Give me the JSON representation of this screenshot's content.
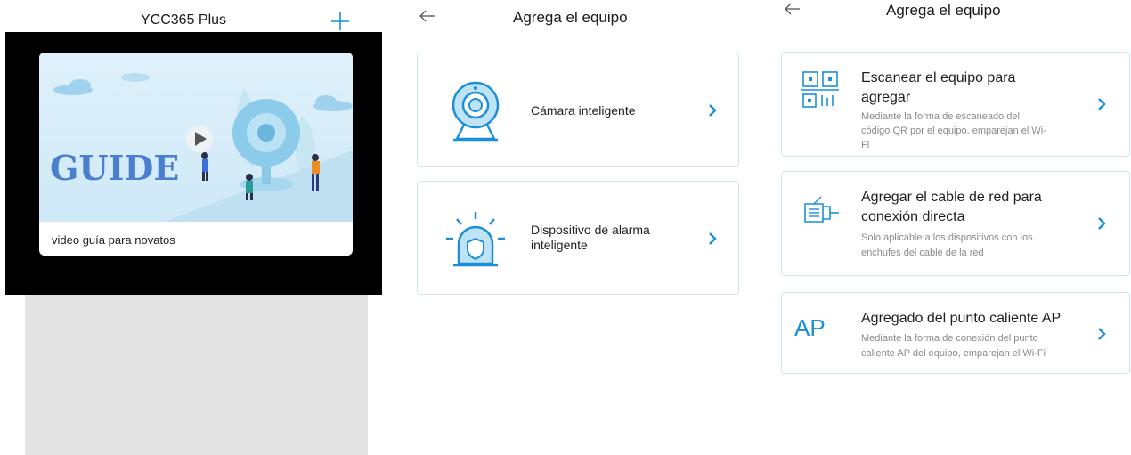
{
  "panel1": {
    "title": "YCC365 Plus",
    "plus_icon": "plus-icon",
    "guide_card": {
      "banner_text": "GUIDE",
      "caption": "video guía para novatos"
    }
  },
  "panel2": {
    "header_title": "Agrega el equipo",
    "items": [
      {
        "label": "Cámara inteligente",
        "icon": "camera-icon"
      },
      {
        "label_line1": "Dispositivo de alarma",
        "label_line2": "inteligente",
        "icon": "alarm-icon"
      }
    ]
  },
  "panel3": {
    "header_title": "Agrega el equipo",
    "options": [
      {
        "title_line1": "Escanear el equipo para",
        "title_line2": "agregar",
        "desc_line1": "Mediante la forma de escaneado del",
        "desc_line2": "código QR por el equipo, emparejan el Wi-",
        "desc_line3": "Fi",
        "icon": "qr-scan-icon"
      },
      {
        "title_line1": "Agregar el cable de red para",
        "title_line2": "conexión directa",
        "desc_line1": "Solo aplicable a los dispositivos con los",
        "desc_line2": "enchufes del cable de la red",
        "icon": "ethernet-cable-icon"
      },
      {
        "title_line1": "Agregado del punto caliente AP",
        "desc_line1": "Mediante la forma de conexión del punto",
        "desc_line2": "caliente AP del equipo, emparejan el Wi-Fi",
        "icon_text": "AP"
      }
    ]
  },
  "colors": {
    "accent": "#1b8fd8",
    "card_border": "#cfe6f3",
    "gray_area": "#e3e3e3"
  }
}
